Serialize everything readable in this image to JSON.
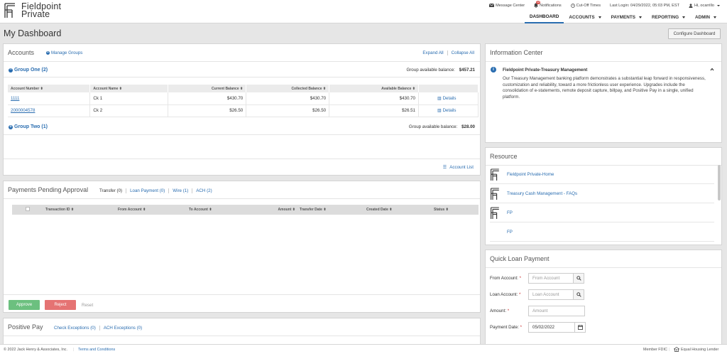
{
  "brand": {
    "line1": "Fieldpoint",
    "line2": "Private"
  },
  "top_links": {
    "message_center": "Message Center",
    "notifications": "Notifications",
    "notifications_badge": "12",
    "cutoff_times": "Cut-Off Times",
    "last_login": "Last Login: 04/29/2022, 05:03 PM, EST",
    "greeting": "Hi, ocarrillo"
  },
  "nav": [
    {
      "label": "DASHBOARD"
    },
    {
      "label": "ACCOUNTS"
    },
    {
      "label": "PAYMENTS"
    },
    {
      "label": "REPORTING"
    },
    {
      "label": "ADMIN"
    }
  ],
  "page": {
    "title": "My Dashboard",
    "configure_button": "Configure Dashboard"
  },
  "accounts": {
    "title": "Accounts",
    "manage_groups": "Manage Groups",
    "expand_all": "Expand All",
    "collapse_all": "Collapse All",
    "groups": [
      {
        "name": "Group One (2)",
        "balance_label": "Group available balance:",
        "balance": "$457.21"
      },
      {
        "name": "Group Two (1)",
        "balance_label": "Group available balance:",
        "balance": "$28.00"
      }
    ],
    "columns": [
      "Account Number",
      "Account Name",
      "Current Balance",
      "Collected Balance",
      "Available Balance"
    ],
    "rows": [
      {
        "number": "1111",
        "name": "Ck 1",
        "current": "$430.70",
        "collected": "$430.70",
        "available": "$430.70",
        "details": "Details"
      },
      {
        "number": "2000004578",
        "name": "Ck 2",
        "current": "$26.50",
        "collected": "$26.50",
        "available": "$26.51",
        "details": "Details"
      }
    ],
    "account_list": "Account List"
  },
  "payments": {
    "title": "Payments Pending Approval",
    "tabs": [
      "Transfer (0)",
      "Loan Payment (0)",
      "Wire (1)",
      "ACH (2)"
    ],
    "columns": [
      "Transaction ID",
      "From Account",
      "To Account",
      "Amount",
      "Transfer Date",
      "Created Date",
      "Status"
    ],
    "approve": "Approve",
    "reject": "Reject",
    "reset": "Reset"
  },
  "positive_pay": {
    "title": "Positive Pay",
    "tabs": [
      "Check Exceptions (0)",
      "ACH Exceptions (0)"
    ]
  },
  "info_center": {
    "title": "Information Center",
    "item_title": "Fieldpoint Private-Treasury Management",
    "item_body": "Our Treasury Management banking platform demonstrates a substantial leap forward in responsiveness, customization and reliability, toward a more frictionless user experience. Upgrades include the consolidation of e-statements, remote deposit capture, billpay, and Positive Pay in a single, unified platform."
  },
  "resource": {
    "title": "Resource",
    "items": [
      "Fieldpoint Private-Home",
      "Treasury Cash Management - FAQs",
      "FP",
      "FP"
    ]
  },
  "quick_loan": {
    "title": "Quick Loan Payment",
    "from_label": "From Account:",
    "from_placeholder": "From Account",
    "loan_label": "Loan Account:",
    "loan_placeholder": "Loan Account",
    "amount_label": "Amount:",
    "amount_placeholder": "Amount",
    "date_label": "Payment Date:",
    "date_value": "05/02/2022"
  },
  "footer": {
    "copyright": "© 2022 Jack Henry & Associates, Inc.",
    "terms": "Terms and Conditions",
    "fdic": "Member FDIC",
    "housing": "Equal Housing Lender"
  },
  "colors": {
    "accent": "#2a6db0",
    "approve": "#6cc07f",
    "reject": "#e57373"
  }
}
